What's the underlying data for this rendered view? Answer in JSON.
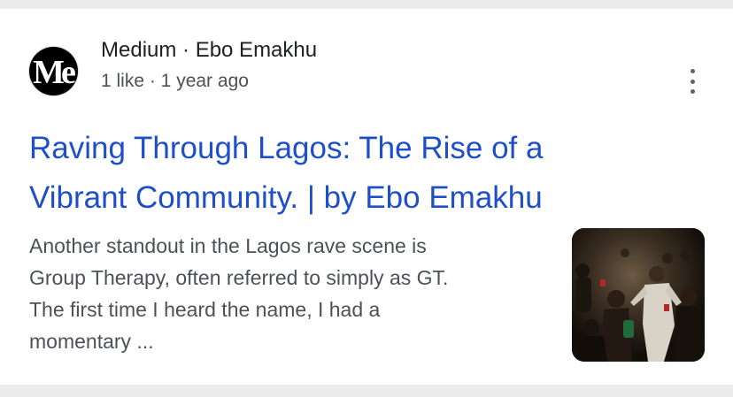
{
  "result": {
    "logo_text": "Me",
    "source": "Medium · Ebo Emakhu",
    "meta": "1 like · 1 year ago",
    "title_line1": "Raving Through Lagos: The Rise of a",
    "title_line2": "Vibrant Community. | by Ebo Emakhu",
    "snippet_lines": [
      "Another standout in the Lagos rave scene is",
      "Group Therapy, often referred to simply as GT.",
      "The first time I heard the name, I had a",
      "momentary ..."
    ],
    "menu_icon": "more-vert-icon",
    "thumbnail_alt": "party-crowd-photo"
  },
  "colors": {
    "title_link": "#1f4fc8",
    "page_bg": "#ebebeb",
    "card_bg": "#ffffff"
  }
}
